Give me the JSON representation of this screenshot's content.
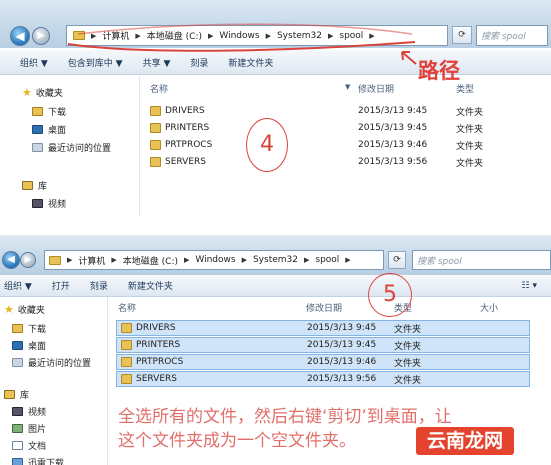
{
  "top": {
    "address": [
      "计算机",
      "本地磁盘 (C:)",
      "Windows",
      "System32",
      "spool"
    ],
    "search_placeholder": "搜索 spool",
    "toolbar": [
      "组织 ▼",
      "包含到库中 ▼",
      "共享 ▼",
      "刻录",
      "新建文件夹"
    ],
    "nav": {
      "favorites": "收藏夹",
      "downloads": "下载",
      "desktop": "桌面",
      "recent": "最近访问的位置",
      "library": "库",
      "video": "视频"
    },
    "columns": {
      "name": "名称",
      "date": "修改日期",
      "type": "类型"
    },
    "files": [
      {
        "name": "DRIVERS",
        "date": "2015/3/13 9:45",
        "type": "文件夹"
      },
      {
        "name": "PRINTERS",
        "date": "2015/3/13 9:45",
        "type": "文件夹"
      },
      {
        "name": "PRTPROCS",
        "date": "2015/3/13 9:46",
        "type": "文件夹"
      },
      {
        "name": "SERVERS",
        "date": "2015/3/13 9:56",
        "type": "文件夹"
      }
    ],
    "step": "4",
    "path_label": "路径"
  },
  "bottom": {
    "address": [
      "计算机",
      "本地磁盘 (C:)",
      "Windows",
      "System32",
      "spool"
    ],
    "search_placeholder": "搜索 spool",
    "toolbar": [
      "组织 ▼",
      "打开",
      "刻录",
      "新建文件夹"
    ],
    "nav": {
      "favorites": "收藏夹",
      "downloads": "下载",
      "desktop": "桌面",
      "recent": "最近访问的位置",
      "library": "库",
      "video": "视频",
      "pictures": "图片",
      "documents": "文档",
      "thunder": "迅雷下载"
    },
    "columns": {
      "name": "名称",
      "date": "修改日期",
      "type": "类型",
      "size": "大小"
    },
    "files": [
      {
        "name": "DRIVERS",
        "date": "2015/3/13 9:45",
        "type": "文件夹"
      },
      {
        "name": "PRINTERS",
        "date": "2015/3/13 9:45",
        "type": "文件夹"
      },
      {
        "name": "PRTPROCS",
        "date": "2015/3/13 9:46",
        "type": "文件夹"
      },
      {
        "name": "SERVERS",
        "date": "2015/3/13 9:56",
        "type": "文件夹"
      }
    ],
    "step": "5",
    "instruction_line1": "全选所有的文件，然后右键‘剪切’到桌面，让",
    "instruction_line2": "这个文件夹成为一个空文件夹。",
    "watermark": "云南龙网"
  },
  "colors": {
    "annotation_red": "#d9453c",
    "selection_blue": "#cfe4f8"
  }
}
